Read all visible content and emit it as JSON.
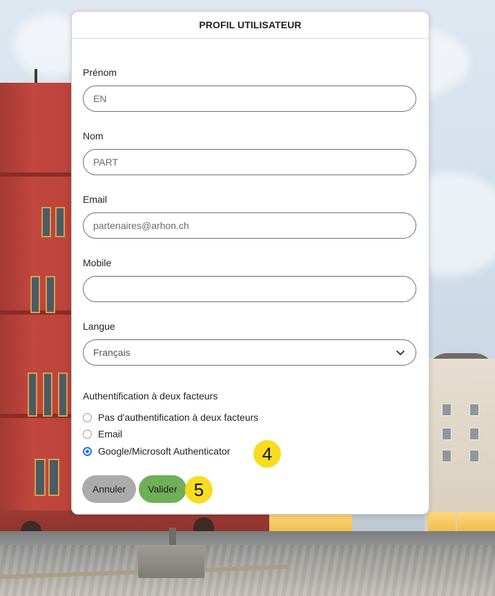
{
  "modal": {
    "title": "PROFIL UTILISATEUR",
    "fields": {
      "firstname": {
        "label": "Prénom",
        "value": "EN"
      },
      "lastname": {
        "label": "Nom",
        "value": "PART"
      },
      "email": {
        "label": "Email",
        "value": "partenaires@arhon.ch"
      },
      "mobile": {
        "label": "Mobile",
        "value": ""
      },
      "language": {
        "label": "Langue",
        "selected": "Français"
      }
    },
    "two_factor": {
      "label": "Authentification à deux facteurs",
      "options": [
        {
          "label": "Pas d'authentification à deux facteurs",
          "checked": false
        },
        {
          "label": "Email",
          "checked": false
        },
        {
          "label": "Google/Microsoft Authenticator",
          "checked": true
        }
      ]
    },
    "buttons": {
      "cancel": "Annuler",
      "validate": "Valider"
    }
  },
  "callouts": {
    "step4": "4",
    "step5": "5"
  },
  "colors": {
    "radio_accent": "#1a73e8",
    "cancel_button": "#ababab",
    "validate_button": "#6faf57",
    "callout": "#f7dc1f"
  },
  "icons": {
    "select_arrow": "chevron-down-icon"
  }
}
